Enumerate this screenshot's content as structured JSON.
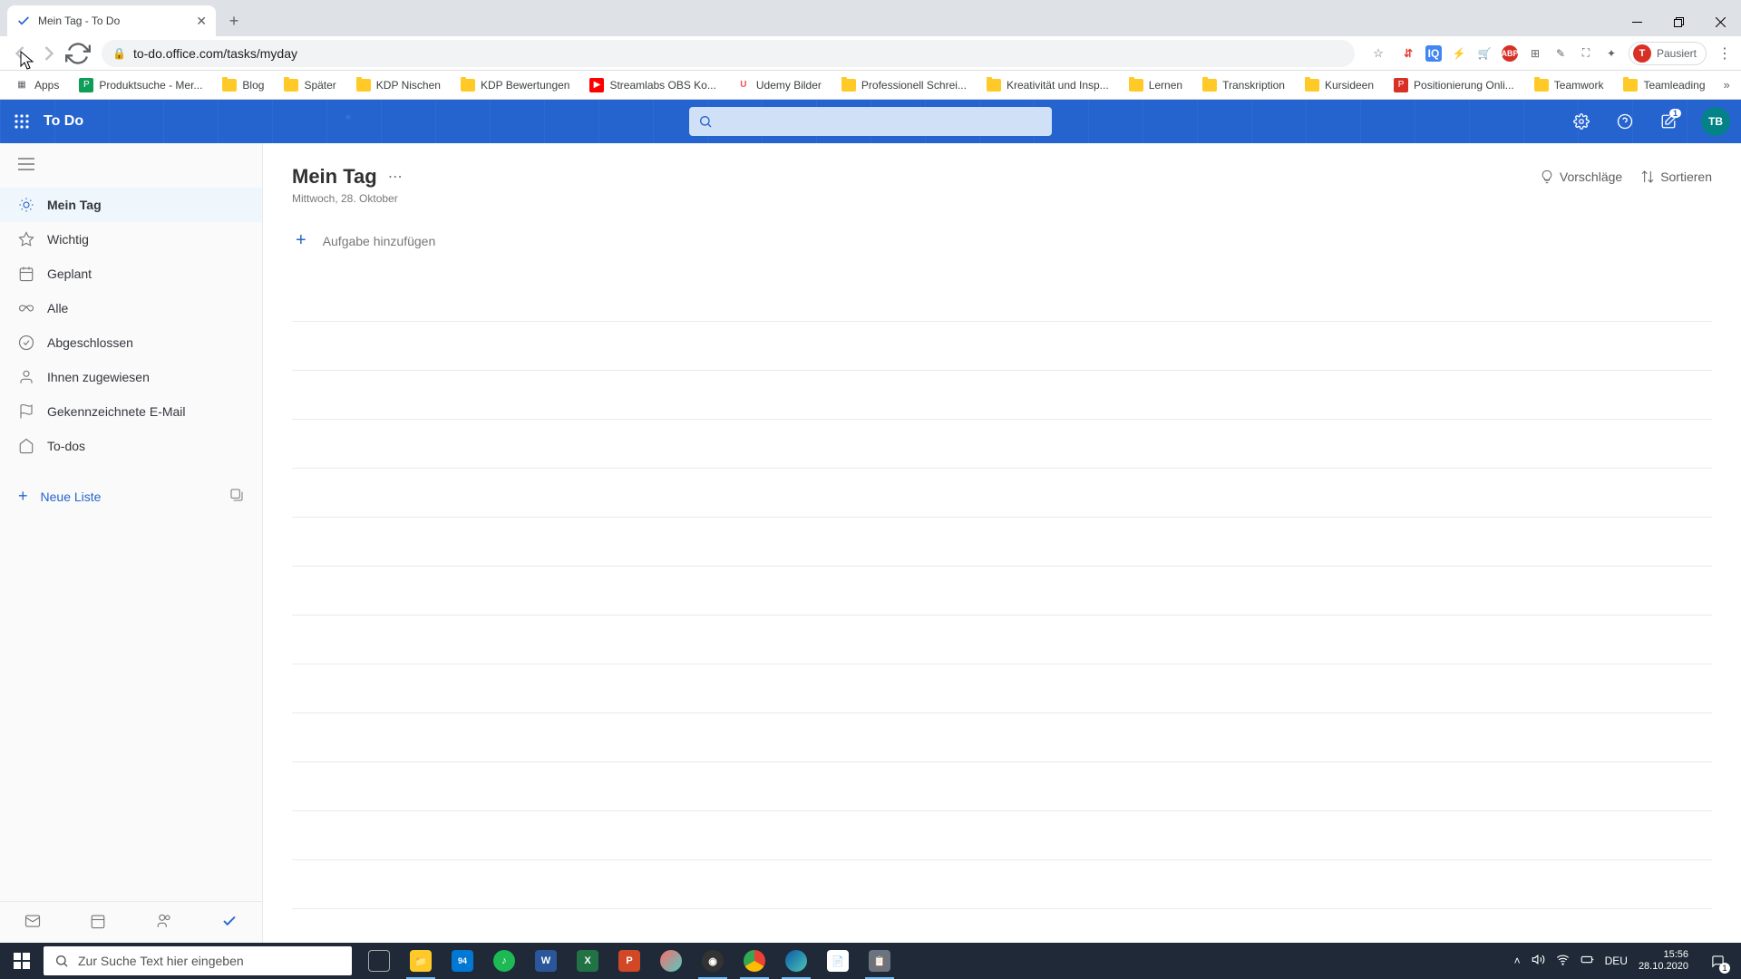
{
  "browser": {
    "tab_title": "Mein Tag - To Do",
    "url": "to-do.office.com/tasks/myday",
    "profile_label": "Pausiert",
    "profile_initial": "T"
  },
  "bookmarks": [
    {
      "label": "Apps",
      "icon": "apps"
    },
    {
      "label": "Produktsuche - Mer...",
      "icon": "green"
    },
    {
      "label": "Blog",
      "icon": "folder"
    },
    {
      "label": "Später",
      "icon": "folder"
    },
    {
      "label": "KDP Nischen",
      "icon": "folder"
    },
    {
      "label": "KDP Bewertungen",
      "icon": "folder"
    },
    {
      "label": "Streamlabs OBS Ko...",
      "icon": "youtube"
    },
    {
      "label": "Udemy Bilder",
      "icon": "udemy"
    },
    {
      "label": "Professionell Schrei...",
      "icon": "folder"
    },
    {
      "label": "Kreativität und Insp...",
      "icon": "folder"
    },
    {
      "label": "Lernen",
      "icon": "folder"
    },
    {
      "label": "Transkription",
      "icon": "folder"
    },
    {
      "label": "Kursideen",
      "icon": "folder"
    },
    {
      "label": "Positionierung Onli...",
      "icon": "red"
    },
    {
      "label": "Teamwork",
      "icon": "folder"
    },
    {
      "label": "Teamleading",
      "icon": "folder"
    }
  ],
  "app": {
    "title": "To Do",
    "notif_count": "1",
    "profile_initials": "TB"
  },
  "sidebar": {
    "items": [
      {
        "label": "Mein Tag",
        "icon": "sun",
        "active": true
      },
      {
        "label": "Wichtig",
        "icon": "star",
        "active": false
      },
      {
        "label": "Geplant",
        "icon": "calendar",
        "active": false
      },
      {
        "label": "Alle",
        "icon": "infinity",
        "active": false
      },
      {
        "label": "Abgeschlossen",
        "icon": "check-circle",
        "active": false
      },
      {
        "label": "Ihnen zugewiesen",
        "icon": "person",
        "active": false
      },
      {
        "label": "Gekennzeichnete E-Mail",
        "icon": "flag",
        "active": false
      },
      {
        "label": "To-dos",
        "icon": "home",
        "active": false
      }
    ],
    "new_list": "Neue Liste"
  },
  "main": {
    "title": "Mein Tag",
    "date": "Mittwoch, 28. Oktober",
    "suggestions": "Vorschläge",
    "sort": "Sortieren",
    "add_task_placeholder": "Aufgabe hinzufügen"
  },
  "taskbar": {
    "search_placeholder": "Zur Suche Text hier eingeben",
    "lang": "DEU",
    "time": "15:56",
    "date": "28.10.2020",
    "notif_count": "1",
    "mail_badge": "94"
  }
}
